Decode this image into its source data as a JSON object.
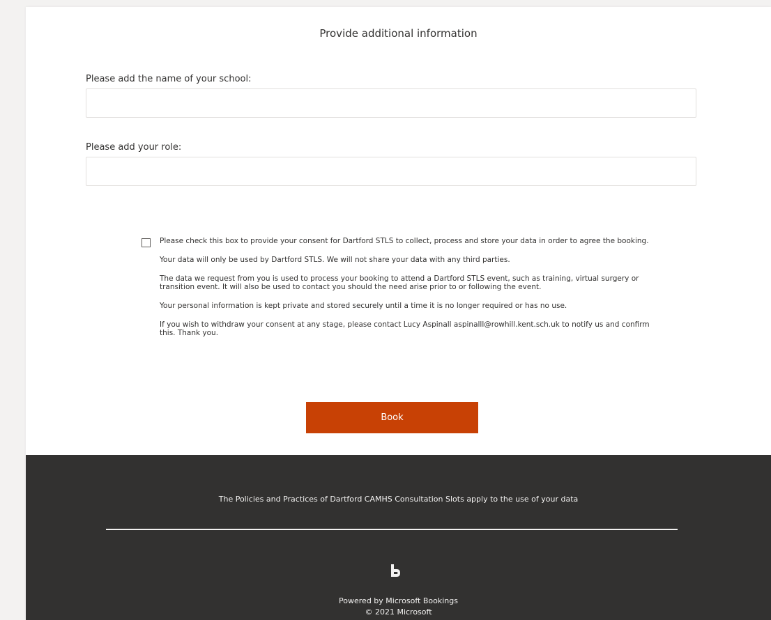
{
  "form": {
    "section_title": "Provide additional information",
    "school_label": "Please add the name of your school:",
    "school_value": "",
    "role_label": "Please add your role:",
    "role_value": ""
  },
  "consent": {
    "checked": false,
    "paragraphs": [
      "Please check this box to provide your consent for Dartford STLS to collect, process and store your data in order to agree the booking.",
      "Your data will only be used by Dartford STLS. We will not share your data with any third parties.",
      "The data we request from you is used to process your booking to attend a Dartford STLS event, such as training, virtual surgery or transition event. It will also be used to contact you should the need arise prior to or following the event.",
      "Your personal information is kept private and stored securely until a time it is no longer required or has no use.",
      "If you wish to withdraw your  consent at any stage, please contact Lucy Aspinall aspinalll@rowhill.kent.sch.uk to notify us and confirm this.  Thank you."
    ]
  },
  "book_button": {
    "label": "Book",
    "color": "#c84105"
  },
  "footer": {
    "policy_text": "The Policies and Practices of Dartford CAMHS Consultation Slots apply to the use of your data",
    "logo_icon": "microsoft-bookings-icon",
    "powered_by": "Powered by Microsoft Bookings",
    "copyright": "© 2021 Microsoft",
    "background_color": "#323130"
  }
}
